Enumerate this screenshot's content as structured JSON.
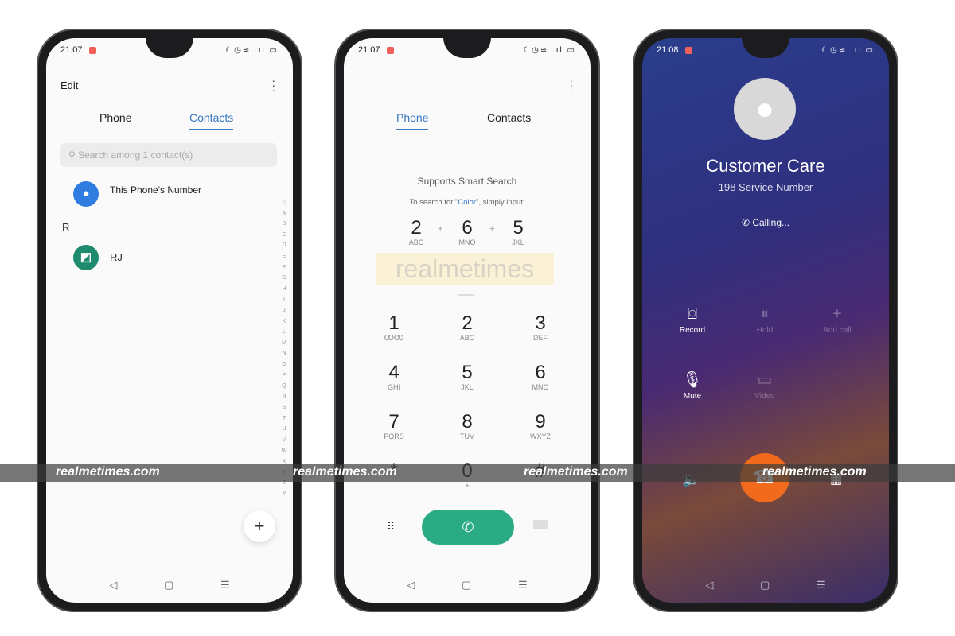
{
  "phone1": {
    "time": "21:07",
    "edit": "Edit",
    "more_icon": "more-vertical-icon",
    "tabs": [
      "Phone",
      "Contacts"
    ],
    "active_tab": "Contacts",
    "search_placeholder": "Search among 1 contact(s)",
    "self_contact": "This Phone's Number",
    "section": "R",
    "contacts": [
      {
        "name": "RJ"
      }
    ],
    "alphabet": [
      "☆",
      "A",
      "B",
      "C",
      "D",
      "E",
      "F",
      "G",
      "H",
      "I",
      "J",
      "K",
      "L",
      "M",
      "N",
      "O",
      "P",
      "Q",
      "R",
      "S",
      "T",
      "U",
      "V",
      "W",
      "X",
      "Y",
      "Z",
      "#"
    ],
    "fab": "+"
  },
  "phone2": {
    "time": "21:07",
    "tabs": [
      "Phone",
      "Contacts"
    ],
    "active_tab": "Phone",
    "hint_title": "Supports Smart Search",
    "hint_pre": "To search for \"",
    "hint_word": "Color",
    "hint_post": "\", simply input:",
    "example": [
      {
        "d": "2",
        "l": "ABC"
      },
      {
        "d": "6",
        "l": "MNO"
      },
      {
        "d": "5",
        "l": "JKL"
      }
    ],
    "plus": "+",
    "logo_watermark": "realmetimes",
    "keys": [
      {
        "d": "1",
        "l": "ꝎꝎ"
      },
      {
        "d": "2",
        "l": "ABC"
      },
      {
        "d": "3",
        "l": "DEF"
      },
      {
        "d": "4",
        "l": "GHI"
      },
      {
        "d": "5",
        "l": "JKL"
      },
      {
        "d": "6",
        "l": "MNO"
      },
      {
        "d": "7",
        "l": "PQRS"
      },
      {
        "d": "8",
        "l": "TUV"
      },
      {
        "d": "9",
        "l": "WXYZ"
      },
      {
        "d": "*",
        "l": ""
      },
      {
        "d": "0",
        "l": "+"
      },
      {
        "d": "#",
        "l": ""
      }
    ]
  },
  "phone3": {
    "time": "21:08",
    "name": "Customer Care",
    "number": "198  Service Number",
    "status": "Calling...",
    "actions": [
      {
        "label": "Record",
        "enabled": true
      },
      {
        "label": "Hold",
        "enabled": false
      },
      {
        "label": "Add call",
        "enabled": false
      },
      {
        "label": "Mute",
        "enabled": true
      },
      {
        "label": "Video",
        "enabled": false
      }
    ],
    "end_color": "#f26b1d"
  },
  "watermark": "realmetimes.com",
  "colors": {
    "accent": "#3a78c2",
    "call_green": "#2bab84",
    "end_orange": "#f26b1d"
  }
}
